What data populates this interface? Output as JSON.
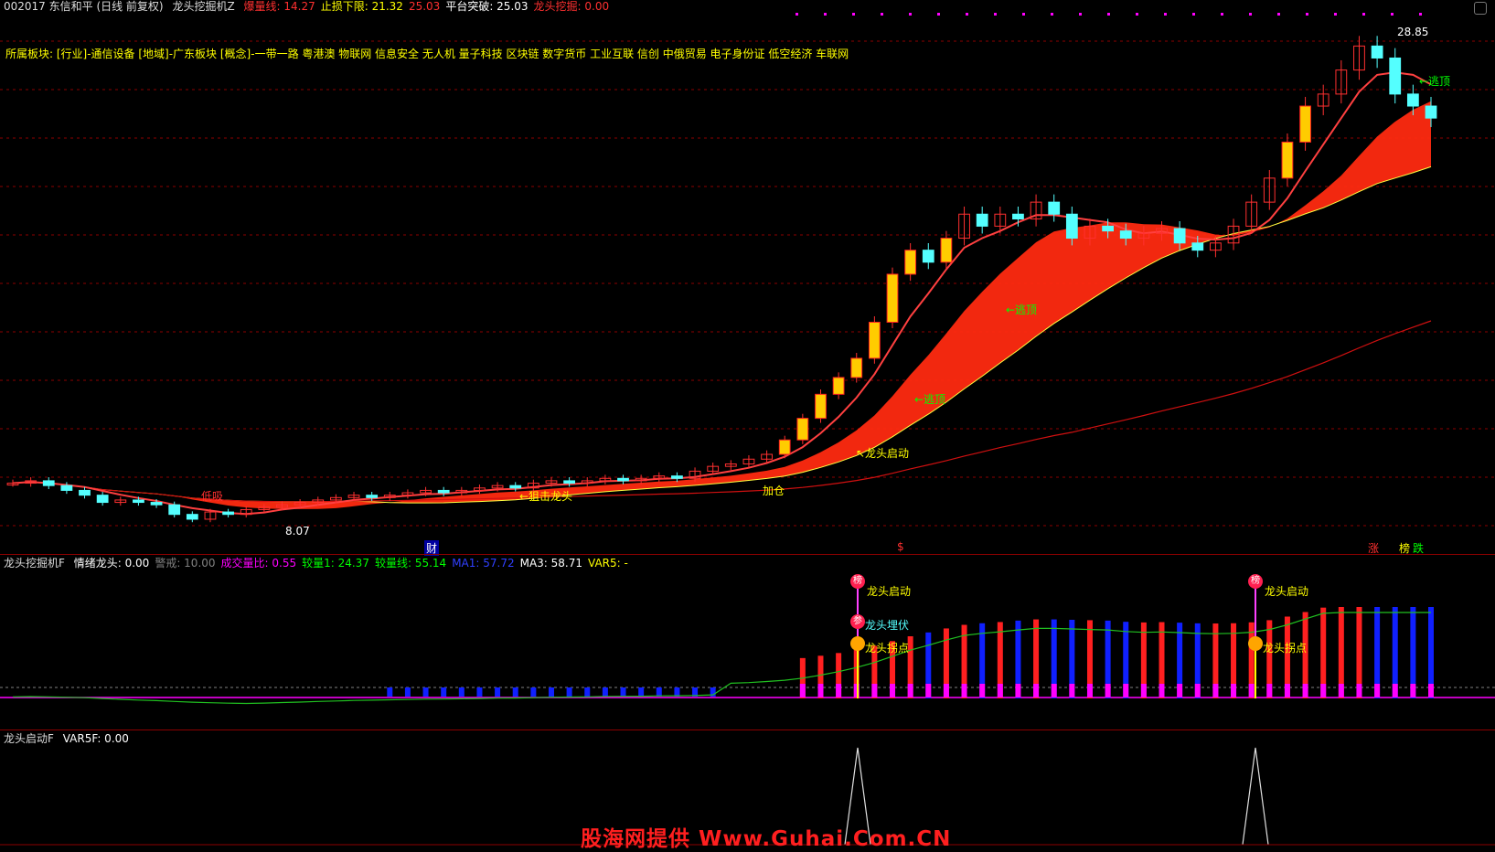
{
  "header": {
    "stock": "002017 东信和平 (日线 前复权)",
    "indicator": "龙头挖掘机Z",
    "items": [
      {
        "label": "爆量线:",
        "value": "14.27",
        "color": "#ff3030"
      },
      {
        "label": "止损下限:",
        "value": "21.32",
        "color": "#ffff00"
      },
      {
        "label": "",
        "value": "25.03",
        "color": "#ff3030"
      },
      {
        "label": "平台突破:",
        "value": "25.03",
        "color": "#ffffff"
      },
      {
        "label": "龙头挖掘:",
        "value": "0.00",
        "color": "#ff3030"
      }
    ]
  },
  "sector_line": "所属板块: [行业]-通信设备 [地域]-广东板块 [概念]-一带一路 粤港澳 物联网 信息安全 无人机 量子科技 区块链 数字货币 工业互联 信创 中俄贸易 电子身份证 低空经济 车联网",
  "main_annotations": {
    "high": "28.85",
    "low": "8.07",
    "escape1": "←逃顶",
    "escape2": "←逃顶",
    "escape3": "←逃顶",
    "low_buy": "低吸",
    "ambush": "←狙击龙头",
    "add": "加仓",
    "launch": "↖龙头启动",
    "cai": "财",
    "dollar": "$",
    "zhang": "涨",
    "bang": "榜",
    "die": "跌"
  },
  "panel2": {
    "title": "龙头挖掘机F",
    "items": [
      {
        "label": "情绪龙头:",
        "value": "0.00",
        "color": "#ffffff"
      },
      {
        "label": "警戒:",
        "value": "10.00",
        "color": "#808080"
      },
      {
        "label": "成交量比:",
        "value": "0.55",
        "color": "#ff00ff"
      },
      {
        "label": "较量1:",
        "value": "24.37",
        "color": "#00ff00"
      },
      {
        "label": "较量线:",
        "value": "55.14",
        "color": "#00ff00"
      },
      {
        "label": "MA1:",
        "value": "57.72",
        "color": "#3040ff"
      },
      {
        "label": "MA3:",
        "value": "58.71",
        "color": "#ffffff"
      },
      {
        "label": "VAR5:",
        "value": "-",
        "color": "#ffff00"
      }
    ],
    "signals": {
      "bang": "榜",
      "launch1": "龙头启动",
      "ambush": "龙头埋伏",
      "turn1": "龙头拐点",
      "launch2": "龙头启动",
      "turn2": "龙头拐点",
      "can": "参"
    }
  },
  "panel3": {
    "title": "龙头启动F",
    "items": [
      {
        "label": "VAR5F:",
        "value": "0.00",
        "color": "#ffffff"
      }
    ]
  },
  "watermark": "股海网提供 Www.Guhai.Com.CN",
  "colors": {
    "up": "#ff3030",
    "down": "#54ffff",
    "bg": "#000000",
    "grid": "#8b0000"
  },
  "chart_data": {
    "type": "candlestick",
    "title": "002017 东信和平 (日线 前复权)",
    "price_high": 28.85,
    "price_low": 8.07,
    "closes": [
      9.8,
      9.9,
      9.7,
      9.5,
      9.3,
      9.0,
      9.1,
      9.0,
      8.9,
      8.5,
      8.3,
      8.6,
      8.5,
      8.7,
      8.8,
      8.9,
      9.0,
      9.1,
      9.2,
      9.3,
      9.2,
      9.3,
      9.4,
      9.5,
      9.4,
      9.5,
      9.6,
      9.7,
      9.6,
      9.8,
      9.9,
      9.8,
      9.9,
      10.0,
      9.9,
      10.0,
      10.1,
      10.0,
      10.3,
      10.5,
      10.6,
      10.8,
      11.0,
      11.6,
      12.5,
      13.5,
      14.2,
      15.0,
      16.5,
      18.5,
      19.5,
      19.0,
      20.0,
      21.0,
      20.5,
      21.0,
      20.8,
      21.5,
      21.0,
      20.0,
      20.5,
      20.3,
      20.0,
      20.2,
      20.4,
      19.8,
      19.5,
      19.8,
      20.5,
      21.5,
      22.5,
      24.0,
      25.5,
      26.0,
      27.0,
      28.0,
      27.5,
      26.0,
      25.5,
      25.0
    ]
  }
}
